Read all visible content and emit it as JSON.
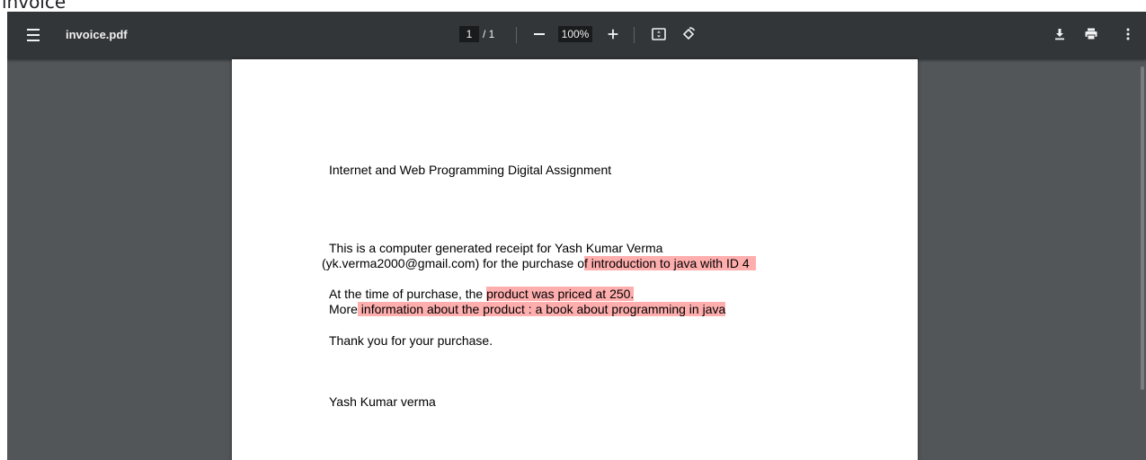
{
  "page": {
    "heading": "invoice"
  },
  "toolbar": {
    "filename": "invoice.pdf",
    "current_page": "1",
    "page_separator": "/ 1",
    "zoom": "100%",
    "zoom_in_label": "+"
  },
  "icons": {
    "menu": "hamburger-menu-icon",
    "zoom_out": "minus-icon",
    "zoom_in": "plus-icon",
    "fit": "fit-to-page-icon",
    "rotate": "rotate-icon",
    "download": "download-icon",
    "print": "print-icon",
    "more": "more-vertical-icon"
  },
  "document": {
    "title": "Internet and Web Programming Digital Assignment",
    "receipt_line1": "This is a computer generated receipt for Yash Kumar Verma",
    "receipt_line2_a": "(yk.verma2000@gmail.com) for the purchase o",
    "receipt_line2_b": "f introduction to java with ID 4",
    "price_line_a": "At the time of purchase, the ",
    "price_line_b": "product was priced at 250.",
    "info_line_a": "More",
    "info_line_b": " information about the product : a book about programming in java",
    "thanks": "Thank you for your purchase.",
    "signature": "Yash Kumar verma"
  },
  "colors": {
    "toolbar_bg": "#323639",
    "viewer_bg": "#525659",
    "highlight": "#ff7878"
  }
}
